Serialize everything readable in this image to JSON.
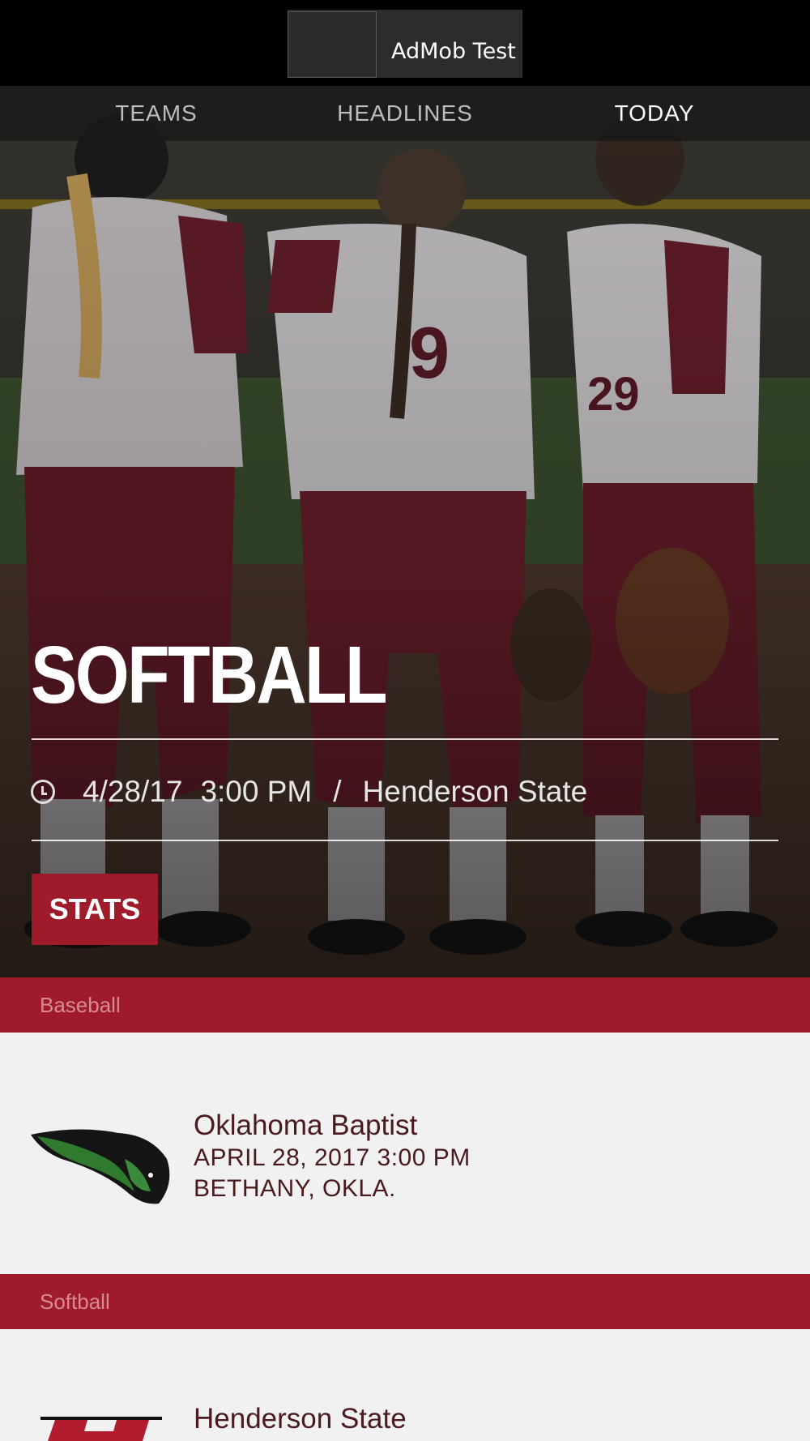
{
  "ad": {
    "label": "AdMob Test S"
  },
  "tabs": [
    {
      "label": "TEAMS"
    },
    {
      "label": "HEADLINES"
    },
    {
      "label": "TODAY"
    }
  ],
  "hero": {
    "sport": "SOFTBALL",
    "date": "4/28/17",
    "time": "3:00 PM",
    "separator": "/",
    "opponent": "Henderson State",
    "stats_label": "STATS"
  },
  "sections": [
    {
      "title": "Baseball",
      "game": {
        "opponent": "Oklahoma Baptist",
        "datetime": "APRIL 28, 2017  3:00 PM",
        "location": "BETHANY, OKLA."
      }
    },
    {
      "title": "Softball",
      "game": {
        "opponent": "Henderson State"
      }
    }
  ],
  "colors": {
    "accent": "#9f1b2a",
    "header_text": "#d58b94",
    "body_text": "#4a1a1e"
  }
}
